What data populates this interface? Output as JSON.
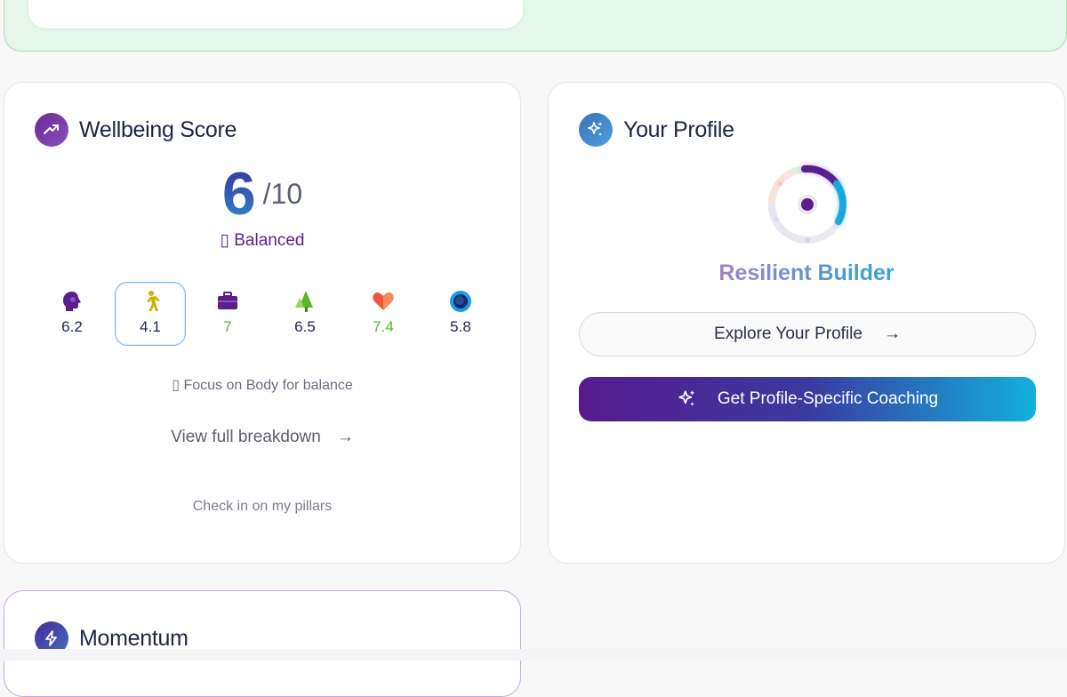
{
  "wellbeing": {
    "title": "Wellbeing Score",
    "score": "6",
    "denominator": "/10",
    "status": "▯ Balanced",
    "pillars": [
      {
        "icon": "head-icon",
        "value": "6.2",
        "color": "#1f2547"
      },
      {
        "icon": "walking-person-icon",
        "value": "4.1",
        "color": "#1f2547",
        "selected": true
      },
      {
        "icon": "briefcase-icon",
        "value": "7",
        "color": "#5ab82e"
      },
      {
        "icon": "tree-icon",
        "value": "6.5",
        "color": "#1f2547"
      },
      {
        "icon": "heart-icon",
        "value": "7.4",
        "color": "#5ab82e"
      },
      {
        "icon": "eye-icon",
        "value": "5.8",
        "color": "#1f2547"
      }
    ],
    "hint": "▯ Focus on Body for balance",
    "breakdown_link": "View full breakdown",
    "checkin_link": "Check in on my pillars"
  },
  "profile": {
    "title": "Your Profile",
    "archetype": "Resilient Builder",
    "explore_button": "Explore Your Profile",
    "coaching_button": "Get Profile-Specific Coaching"
  },
  "momentum": {
    "title": "Momentum"
  },
  "colors": {
    "accent_purple": "#561a8c",
    "accent_blue": "#12b0dc",
    "positive_green": "#5ab82e"
  }
}
